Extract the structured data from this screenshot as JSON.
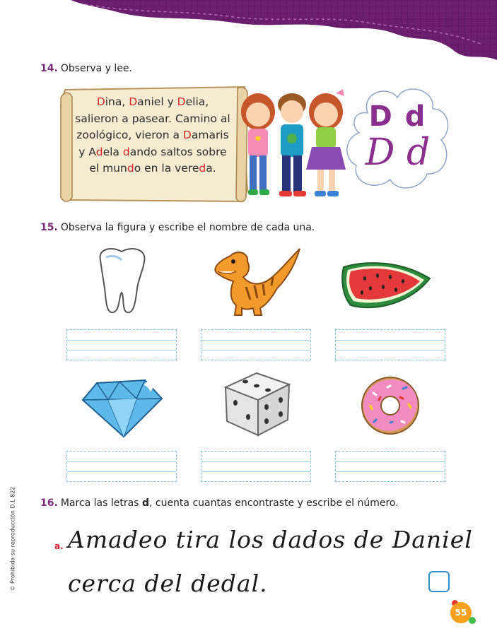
{
  "header": {
    "band_color": "#6b1f6e",
    "band_color_light": "#8c3a8f"
  },
  "ex14": {
    "number": "14.",
    "instruction": "Observa y lee.",
    "story": [
      [
        {
          "t": "D",
          "h": true
        },
        {
          "t": "ina, ",
          "h": false
        },
        {
          "t": "D",
          "h": true
        },
        {
          "t": "aniel y ",
          "h": false
        },
        {
          "t": "D",
          "h": true
        },
        {
          "t": "elia,",
          "h": false
        }
      ],
      [
        {
          "t": "salieron a pasear. Camino al",
          "h": false
        }
      ],
      [
        {
          "t": "zoológico, vieron a ",
          "h": false
        },
        {
          "t": "D",
          "h": true
        },
        {
          "t": "amaris",
          "h": false
        }
      ],
      [
        {
          "t": "y A",
          "h": false
        },
        {
          "t": "d",
          "h": true
        },
        {
          "t": "ela ",
          "h": false
        },
        {
          "t": "d",
          "h": true
        },
        {
          "t": "ando saltos sobre",
          "h": false
        }
      ],
      [
        {
          "t": "el mun",
          "h": false
        },
        {
          "t": "d",
          "h": true
        },
        {
          "t": "o en la vere",
          "h": false
        },
        {
          "t": "d",
          "h": true
        },
        {
          "t": "a.",
          "h": false
        }
      ]
    ],
    "letter_print": "D d",
    "letter_cursive": "D d",
    "accent_color": "#8b2f8e",
    "highlight_color": "#d8232a"
  },
  "ex15": {
    "number": "15.",
    "instruction": "Observa la figura y escribe el nombre de cada una.",
    "images": [
      "tooth-icon",
      "dinosaur-icon",
      "watermelon-icon",
      "diamond-icon",
      "dice-icon",
      "donut-icon"
    ]
  },
  "ex16": {
    "number": "16.",
    "instruction_before": "Marca las letras ",
    "instruction_bold": "d",
    "instruction_after": ", cuenta cuantas encontraste y escribe el número.",
    "item_label": "a.",
    "line1": "Amadeo tira los dados de Daniel",
    "line2": "cerca del dedal."
  },
  "footer": {
    "copyright": "© Prohibida su reproducción D.L 822",
    "page_number": "55"
  }
}
